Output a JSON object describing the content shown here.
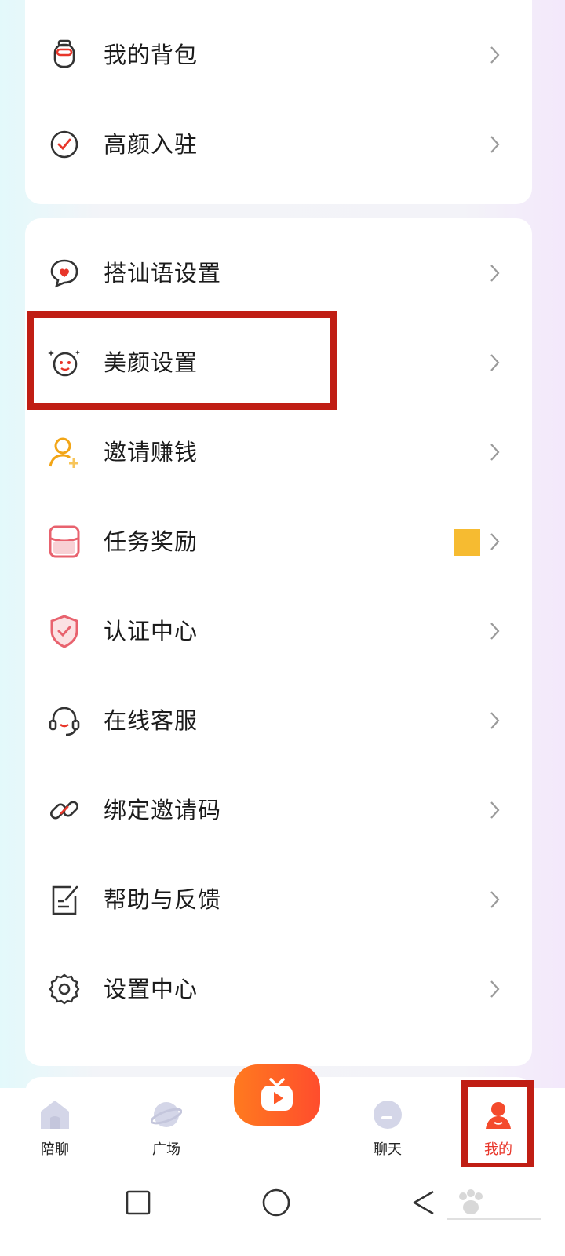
{
  "menu_top": [
    {
      "label": "我的背包",
      "icon": "backpack-icon"
    },
    {
      "label": "高颜入驻",
      "icon": "check-circle-icon"
    }
  ],
  "menu_main": [
    {
      "label": "搭讪语设置",
      "icon": "chat-heart-icon"
    },
    {
      "label": "美颜设置",
      "icon": "beauty-face-icon"
    },
    {
      "label": "邀请赚钱",
      "icon": "invite-user-icon"
    },
    {
      "label": "任务奖励",
      "icon": "task-reward-icon"
    },
    {
      "label": "认证中心",
      "icon": "shield-check-icon"
    },
    {
      "label": "在线客服",
      "icon": "headset-icon"
    },
    {
      "label": "绑定邀请码",
      "icon": "link-icon"
    },
    {
      "label": "帮助与反馈",
      "icon": "feedback-icon"
    },
    {
      "label": "设置中心",
      "icon": "gear-icon"
    }
  ],
  "tabbar": {
    "tabs": [
      {
        "label": "陪聊",
        "icon": "home-icon"
      },
      {
        "label": "广场",
        "icon": "planet-icon"
      },
      {
        "label": "聊天",
        "icon": "chat-bubble-icon"
      },
      {
        "label": "我的",
        "icon": "profile-icon"
      }
    ],
    "live_button_icon": "tv-play-icon",
    "active_color": "#e8362a"
  },
  "system_nav": [
    "recents-icon",
    "home-circle-icon",
    "back-icon"
  ],
  "colors": {
    "accent": "#e8362a",
    "highlight_box": "#c01e14",
    "badge": "#f6bb31",
    "live_gradient": [
      "#ff7a1f",
      "#ff4d2d"
    ]
  }
}
